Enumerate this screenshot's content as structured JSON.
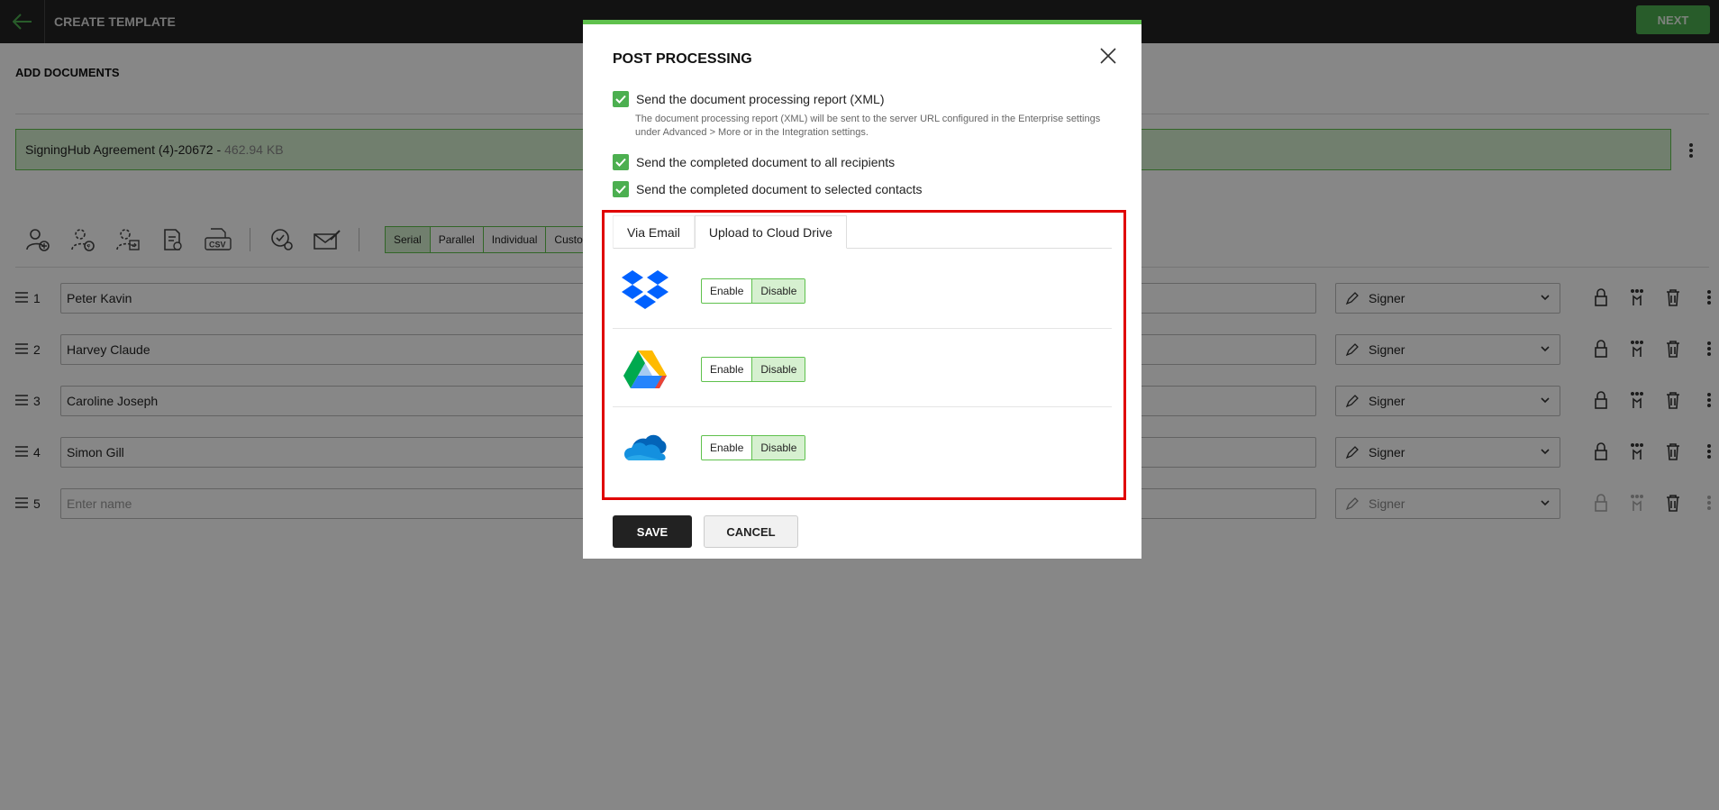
{
  "header": {
    "title": "CREATE TEMPLATE",
    "next_label": "NEXT",
    "back_icon": "arrow-left-icon"
  },
  "documents": {
    "section_title": "ADD DOCUMENTS",
    "file_name": "SigningHub Agreement (4)-20672 -",
    "file_size": "462.94 KB"
  },
  "toolbar": {
    "icons": [
      "add-user-icon",
      "add-placeholder-icon",
      "import-user-icon",
      "add-reviewer-icon",
      "csv-icon",
      "settings-check-icon",
      "envelope-pen-icon"
    ],
    "workflow_options": [
      "Serial",
      "Parallel",
      "Individual",
      "Custom"
    ],
    "selected_workflow": "Serial"
  },
  "recipients": [
    {
      "number": "1",
      "name": "Peter Kavin",
      "role": "Signer"
    },
    {
      "number": "2",
      "name": "Harvey Claude",
      "role": "Signer"
    },
    {
      "number": "3",
      "name": "Caroline Joseph",
      "role": "Signer"
    },
    {
      "number": "4",
      "name": "Simon Gill",
      "role": "Signer"
    },
    {
      "number": "5",
      "name_placeholder": "Enter name",
      "role": "Signer"
    }
  ],
  "modal": {
    "title": "POST PROCESSING",
    "options": [
      {
        "label": "Send the document processing report (XML)",
        "checked": true
      },
      {
        "label": "Send the completed document to all recipients",
        "checked": true
      },
      {
        "label": "Send the completed document to selected contacts",
        "checked": true
      }
    ],
    "xml_note": "The document processing report (XML) will be sent to the server URL configured in the Enterprise settings under Advanced > More or in the Integration settings.",
    "tabs": [
      {
        "label": "Via Email",
        "active": false
      },
      {
        "label": "Upload to Cloud Drive",
        "active": true
      }
    ],
    "cloud_drives": [
      {
        "icon": "dropbox-icon",
        "enable_label": "Enable",
        "disable_label": "Disable",
        "selected": "Disable"
      },
      {
        "icon": "google-drive-icon",
        "enable_label": "Enable",
        "disable_label": "Disable",
        "selected": "Disable"
      },
      {
        "icon": "onedrive-icon",
        "enable_label": "Enable",
        "disable_label": "Disable",
        "selected": "Disable"
      }
    ],
    "save_label": "SAVE",
    "cancel_label": "CANCEL"
  },
  "colors": {
    "brand_green": "#4caf50",
    "highlight_red": "#e00000"
  }
}
